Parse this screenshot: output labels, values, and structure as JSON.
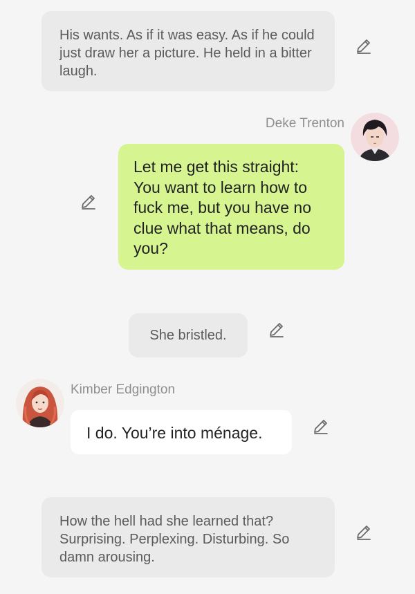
{
  "messages": [
    {
      "type": "narration",
      "text": "His wants. As if it was easy. As if he could just draw her a picture. He held in a bitter laugh."
    },
    {
      "type": "dialogue",
      "speaker": "Deke Trenton",
      "avatar_icon": "male-character-avatar",
      "bubble_color": "#d6f590",
      "text": "Let me get this straight: You want to learn how to fuck me, but you have no clue what that means, do you?"
    },
    {
      "type": "narration",
      "text": "She bristled."
    },
    {
      "type": "dialogue",
      "speaker": "Kimber Edgington",
      "avatar_icon": "female-character-avatar",
      "bubble_color": "#ffffff",
      "text": "I do. You’re into ménage."
    },
    {
      "type": "narration",
      "text": "How the hell had she learned that? Surprising. Perplexing. Disturbing. So damn arousing."
    }
  ],
  "icons": {
    "edit": "pencil-edit-icon"
  },
  "colors": {
    "background": "#f5f5f5",
    "narration_bubble": "#eaeaea",
    "speaker_name": "#8e8e8e",
    "green_bubble": "#d6f590"
  }
}
